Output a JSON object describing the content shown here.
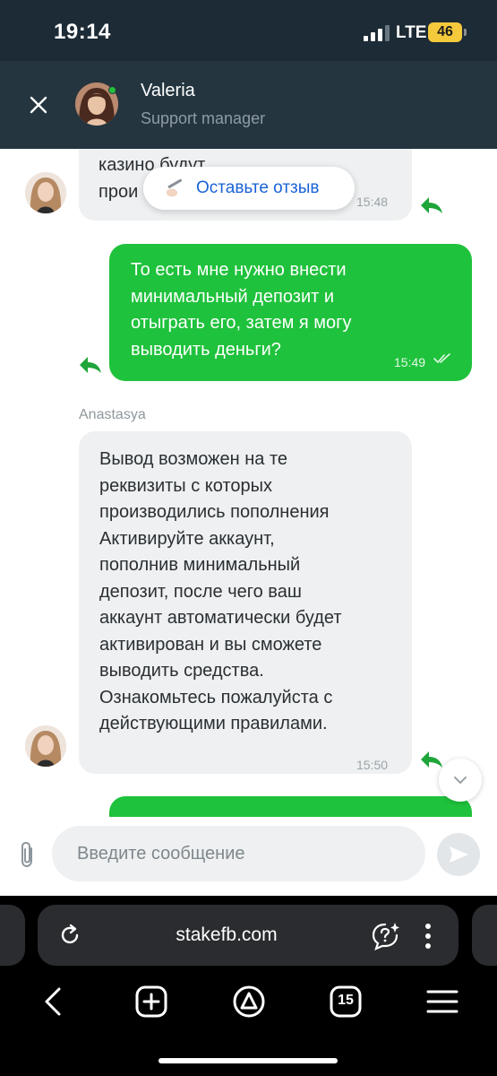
{
  "status_bar": {
    "time": "19:14",
    "network": "LTE",
    "battery": "46"
  },
  "header": {
    "agent_name": "Valeria",
    "agent_role": "Support manager"
  },
  "review_prompt": {
    "label": "Оставьте отзыв"
  },
  "messages": [
    {
      "direction": "incoming",
      "text": "казино будут\nпрои",
      "time": "15:48"
    },
    {
      "direction": "outgoing",
      "text": "То есть мне нужно внести\nминимальный депозит и\nотыграть его, затем я могу\nвыводить деньги?",
      "time": "15:49"
    },
    {
      "direction": "incoming",
      "sender": "Anastasya",
      "text": "Вывод возможен на те\nреквизиты с которых\nпроизводились пополнения\nАктивируйте аккаунт,\nпополнив минимальный\nдепозит, после чего ваш\nаккаунт автоматически будет\nактивирован и вы сможете\nвыводить средства.\nОзнакомьтесь пожалуйста с\nдействующими правилами.",
      "time": "15:50"
    }
  ],
  "composer": {
    "placeholder": "Введите сообщение"
  },
  "browser": {
    "url": "stakefb.com",
    "tab_count": "15"
  },
  "colors": {
    "outgoing_bubble": "#1fc23c",
    "incoming_bubble": "#eef0f1",
    "header_bg": "#24353f",
    "link_blue": "#1a62d6"
  },
  "icons": [
    "close-icon",
    "reply-arrow-icon",
    "double-check-icon",
    "chevron-down-icon",
    "paperclip-icon",
    "send-icon",
    "reload-icon",
    "assistant-icon",
    "more-vertical-icon",
    "back-icon",
    "new-tab-icon",
    "alice-icon",
    "tabs-icon",
    "menu-icon"
  ]
}
